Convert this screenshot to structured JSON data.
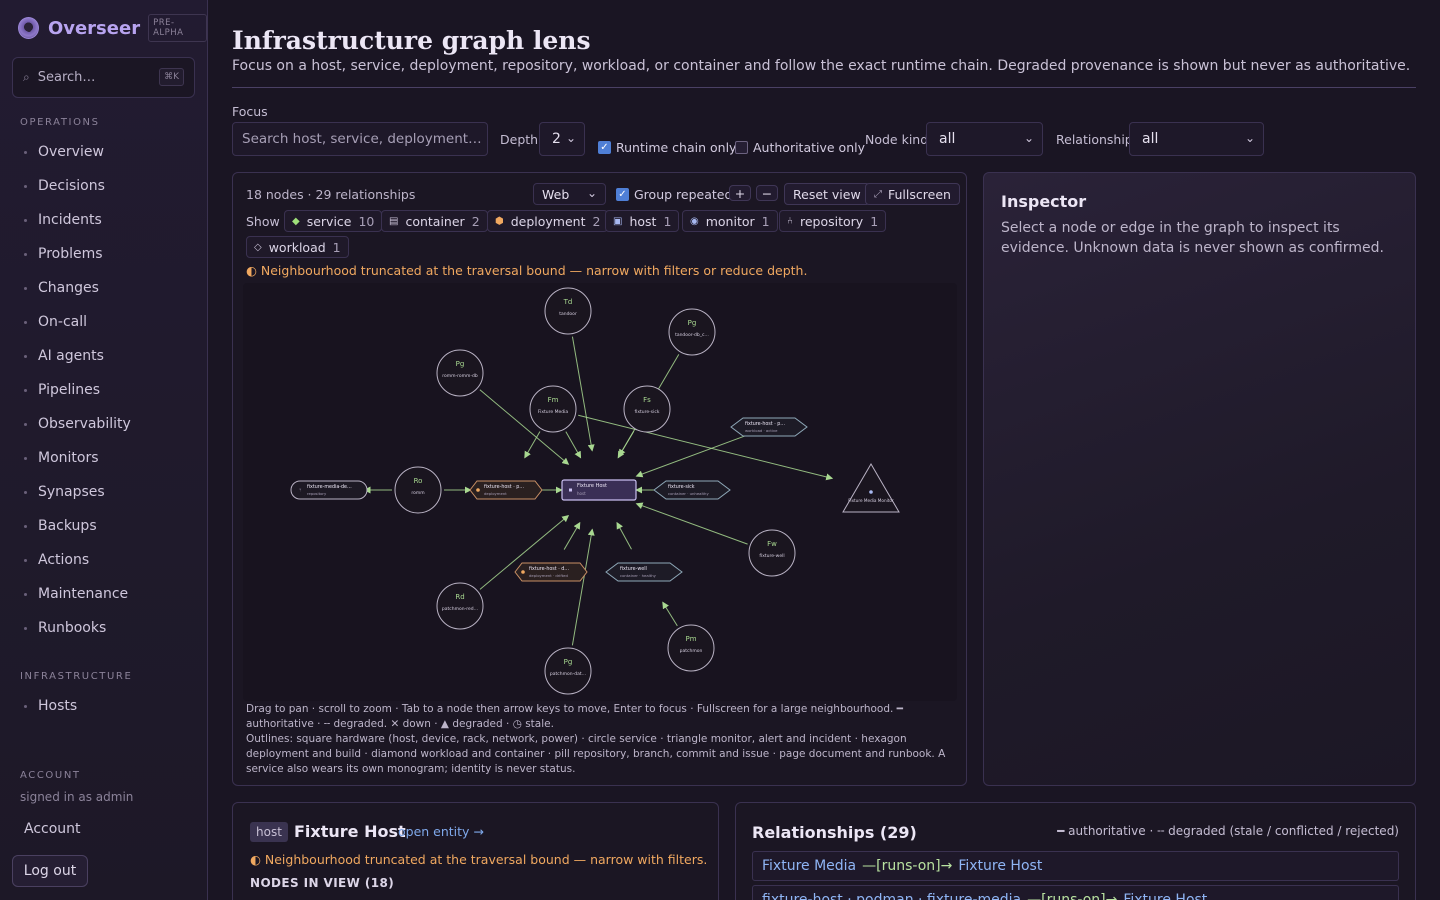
{
  "app": {
    "name": "Overseer",
    "badge": "PRE-ALPHA"
  },
  "search": {
    "placeholder": "Search…",
    "shortcut": "⌘K"
  },
  "nav": {
    "operations_heading": "OPERATIONS",
    "operations": [
      "Overview",
      "Decisions",
      "Incidents",
      "Problems",
      "Changes",
      "On-call",
      "AI agents",
      "Pipelines",
      "Observability",
      "Monitors",
      "Synapses",
      "Backups",
      "Actions",
      "Maintenance",
      "Runbooks"
    ],
    "infrastructure_heading": "INFRASTRUCTURE",
    "infrastructure": [
      "Hosts"
    ],
    "account_heading": "ACCOUNT",
    "signed_in": "signed in as admin",
    "account_link": "Account",
    "logout": "Log out"
  },
  "page": {
    "title": "Infrastructure graph lens",
    "subtitle": "Focus on a host, service, deployment, repository, workload, or container and follow the exact runtime chain. Degraded provenance is shown but never as authoritative."
  },
  "filters": {
    "focus_label": "Focus",
    "focus_placeholder": "Search host, service, deployment…",
    "depth_label": "Depth",
    "depth_value": "2",
    "runtime_only": {
      "label": "Runtime chain only",
      "checked": true
    },
    "authoritative_only": {
      "label": "Authoritative only",
      "checked": false
    },
    "node_kind_label": "Node kind",
    "node_kind_value": "all",
    "relationship_label": "Relationship",
    "relationship_value": "all"
  },
  "graph": {
    "counts": "18 nodes · 29 relationships",
    "layout_value": "Web",
    "group_repeated": {
      "label": "Group repeated",
      "checked": true
    },
    "zoom_in": "+",
    "zoom_out": "−",
    "reset": "Reset view",
    "fullscreen": "Fullscreen",
    "show_label": "Show",
    "chips": [
      {
        "label": "service",
        "count": "10",
        "icon": "diamond-icon",
        "color": "#9fe07a"
      },
      {
        "label": "container",
        "count": "2",
        "icon": "container-icon",
        "color": "#c9c1d6"
      },
      {
        "label": "deployment",
        "count": "2",
        "icon": "hexagon-icon",
        "color": "#f0a860"
      },
      {
        "label": "host",
        "count": "1",
        "icon": "host-icon",
        "color": "#a8b8f0"
      },
      {
        "label": "monitor",
        "count": "1",
        "icon": "monitor-icon",
        "color": "#a8b8f0"
      },
      {
        "label": "repository",
        "count": "1",
        "icon": "branch-icon",
        "color": "#c9c1d6"
      },
      {
        "label": "workload",
        "count": "1",
        "icon": "workload-icon",
        "color": "#c9c1d6"
      }
    ],
    "warning": "◐ Neighbourhood truncated at the traversal bound — narrow with filters or reduce depth.",
    "nodes": [
      {
        "id": "td",
        "abbr": "Td",
        "label": "tandoor",
        "sub": "",
        "shape": "circle"
      },
      {
        "id": "pg1",
        "abbr": "Pg",
        "label": "tandoor-db_c…",
        "sub": "",
        "shape": "circle"
      },
      {
        "id": "pg2",
        "abbr": "Pg",
        "label": "romm-romm-db",
        "sub": "",
        "shape": "circle"
      },
      {
        "id": "fm",
        "abbr": "Fm",
        "label": "Fixture Media",
        "sub": "",
        "shape": "circle"
      },
      {
        "id": "fs",
        "abbr": "Fs",
        "label": "fixture-sick",
        "sub": "",
        "shape": "circle"
      },
      {
        "id": "ro",
        "abbr": "Ro",
        "label": "romm",
        "sub": "",
        "shape": "circle"
      },
      {
        "id": "fw",
        "abbr": "Fw",
        "label": "fixture-well",
        "sub": "",
        "shape": "circle"
      },
      {
        "id": "rd",
        "abbr": "Rd",
        "label": "patchmon-red…",
        "sub": "",
        "shape": "circle"
      },
      {
        "id": "pm",
        "abbr": "Pm",
        "label": "patchmon",
        "sub": "",
        "shape": "circle"
      },
      {
        "id": "pg3",
        "abbr": "Pg",
        "label": "patchmon-dat…",
        "sub": "",
        "shape": "circle"
      },
      {
        "id": "host",
        "abbr": "",
        "label": "Fixture Host",
        "sub": "host",
        "shape": "rect"
      },
      {
        "id": "dep1",
        "abbr": "",
        "label": "fixture-host · p…",
        "sub": "deployment",
        "shape": "hexagon"
      },
      {
        "id": "dep2",
        "abbr": "",
        "label": "fixture-host · d…",
        "sub": "deployment · drifted",
        "shape": "hexagon"
      },
      {
        "id": "wl",
        "abbr": "",
        "label": "fixture-host · p…",
        "sub": "workload · active",
        "shape": "diamond"
      },
      {
        "id": "c1",
        "abbr": "",
        "label": "fixture-sick",
        "sub": "container · unhealthy",
        "shape": "diamond"
      },
      {
        "id": "c2",
        "abbr": "",
        "label": "fixture-well",
        "sub": "container · healthy",
        "shape": "diamond"
      },
      {
        "id": "repo",
        "abbr": "",
        "label": "fixture-media-de…",
        "sub": "repository",
        "shape": "pill"
      },
      {
        "id": "mon",
        "abbr": "",
        "label": "Fixture Media Monitor",
        "sub": "",
        "shape": "triangle"
      }
    ],
    "help_line1": "Drag to pan · scroll to zoom · Tab to a node then arrow keys to move, Enter to focus · Fullscreen for a large neighbourhood. ━ authoritative · ╌ degraded. ✕ down · ▲ degraded · ◷ stale.",
    "help_line2": "Outlines: square hardware (host, device, rack, network, power) · circle service · triangle monitor, alert and incident · hexagon deployment and build · diamond workload and container · pill repository, branch, commit and issue · page document and runbook. A service also wears its own monogram; identity is never status."
  },
  "inspector": {
    "title": "Inspector",
    "text": "Select a node or edge in the graph to inspect its evidence. Unknown data is never shown as confirmed."
  },
  "entity": {
    "kind": "host",
    "name": "Fixture Host",
    "open": "open entity →",
    "warning": "◐ Neighbourhood truncated at the traversal bound — narrow with filters.",
    "nodes_in_view": "NODES IN VIEW (18)"
  },
  "relationships": {
    "title": "Relationships (29)",
    "legend": "━ authoritative · ╌ degraded (stale / conflicted / rejected)",
    "rows": [
      {
        "from": "Fixture Media",
        "edge": "—[runs-on]→",
        "to": "Fixture Host"
      },
      {
        "from": "fixture-host · podman · fixture-media",
        "edge": "—[runs-on]→",
        "to": "Fixture Host"
      }
    ]
  },
  "colors": {
    "accent": "#b8a4f0",
    "edge": "#a8d890",
    "warning": "#f0a860",
    "link": "#7fa8ea"
  }
}
